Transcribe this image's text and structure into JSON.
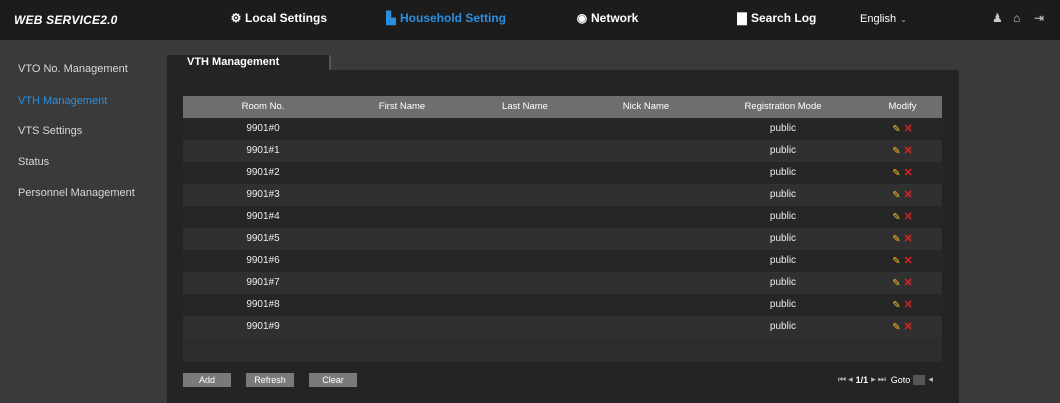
{
  "header": {
    "logo": "WEB SERVICE2.0",
    "nav": [
      {
        "label": "Local Settings",
        "icon": "gear-icon",
        "active": false
      },
      {
        "label": "Household Setting",
        "icon": "building-icon",
        "active": true
      },
      {
        "label": "Network",
        "icon": "globe-icon",
        "active": false
      },
      {
        "label": "Search Log",
        "icon": "document-icon",
        "active": false
      }
    ],
    "language": "English",
    "icons": [
      "user-icon",
      "home-icon",
      "logout-icon"
    ]
  },
  "sidebar": {
    "items": [
      {
        "label": "VTO No. Management",
        "active": false
      },
      {
        "label": "VTH Management",
        "active": true
      },
      {
        "label": "VTS Settings",
        "active": false
      },
      {
        "label": "Status",
        "active": false
      },
      {
        "label": "Personnel Management",
        "active": false
      }
    ]
  },
  "panel": {
    "tab": "VTH Management",
    "columns": [
      "Room No.",
      "First Name",
      "Last Name",
      "Nick Name",
      "Registration Mode",
      "Modify"
    ],
    "rows": [
      {
        "room": "9901#0",
        "first": "",
        "last": "",
        "nick": "",
        "mode": "public"
      },
      {
        "room": "9901#1",
        "first": "",
        "last": "",
        "nick": "",
        "mode": "public"
      },
      {
        "room": "9901#2",
        "first": "",
        "last": "",
        "nick": "",
        "mode": "public"
      },
      {
        "room": "9901#3",
        "first": "",
        "last": "",
        "nick": "",
        "mode": "public"
      },
      {
        "room": "9901#4",
        "first": "",
        "last": "",
        "nick": "",
        "mode": "public"
      },
      {
        "room": "9901#5",
        "first": "",
        "last": "",
        "nick": "",
        "mode": "public"
      },
      {
        "room": "9901#6",
        "first": "",
        "last": "",
        "nick": "",
        "mode": "public"
      },
      {
        "room": "9901#7",
        "first": "",
        "last": "",
        "nick": "",
        "mode": "public"
      },
      {
        "room": "9901#8",
        "first": "",
        "last": "",
        "nick": "",
        "mode": "public"
      },
      {
        "room": "9901#9",
        "first": "",
        "last": "",
        "nick": "",
        "mode": "public"
      }
    ],
    "buttons": {
      "add": "Add",
      "refresh": "Refresh",
      "clear": "Clear"
    },
    "pager": {
      "page": "1/1",
      "goto": "Goto"
    }
  }
}
